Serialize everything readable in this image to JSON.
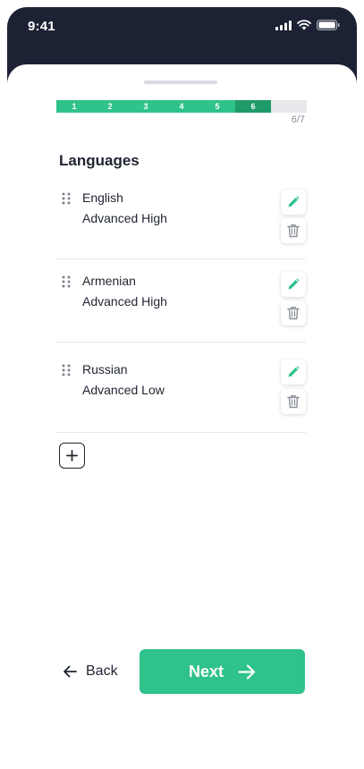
{
  "status_bar": {
    "time": "9:41"
  },
  "progress": {
    "steps": [
      "1",
      "2",
      "3",
      "4",
      "5",
      "6",
      ""
    ],
    "current_step": 6,
    "total_steps": 7,
    "counter": "6/7",
    "colors": {
      "done": "#2fc28b",
      "current": "#1f9a69",
      "todo": "#e6e8eb"
    }
  },
  "section": {
    "title": "Languages"
  },
  "languages": [
    {
      "name": "English",
      "level": "Advanced High"
    },
    {
      "name": "Armenian",
      "level": "Advanced High"
    },
    {
      "name": "Russian",
      "level": "Advanced Low"
    }
  ],
  "icons": {
    "drag": "drag-handle-icon",
    "edit": "pencil-icon",
    "delete": "trash-icon",
    "add": "plus-icon",
    "back": "arrow-left-icon",
    "next": "arrow-right-icon"
  },
  "footer": {
    "back_label": "Back",
    "next_label": "Next"
  },
  "colors": {
    "accent": "#2fc28b",
    "header_dark": "#1c2134",
    "text": "#1f2430"
  }
}
